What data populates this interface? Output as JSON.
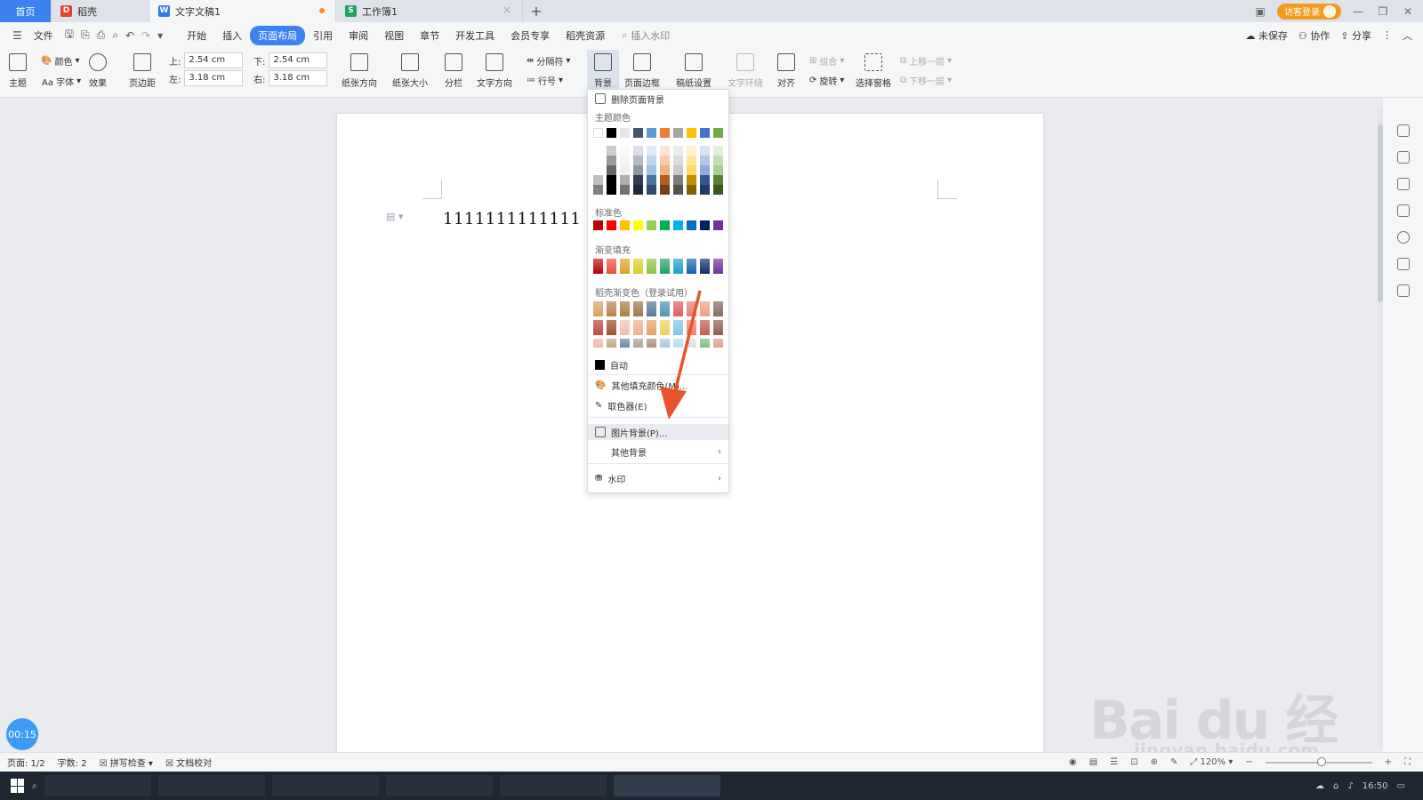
{
  "tabs": {
    "home": "首页",
    "daoke": "稻壳",
    "doc": "文字文稿1",
    "sheet": "工作簿1",
    "new": "+",
    "login": "访客登录"
  },
  "menu": {
    "file": "文件",
    "items": [
      "开始",
      "插入",
      "页面布局",
      "引用",
      "审阅",
      "视图",
      "章节",
      "开发工具",
      "会员专享",
      "稻壳资源"
    ],
    "active_index": 2,
    "search_placeholder": "插入水印",
    "unsaved": "未保存",
    "collab": "协作",
    "share": "分享"
  },
  "ribbon": {
    "theme": "主题",
    "color": "颜色",
    "font": "Aa 字体",
    "effect": "效果",
    "margin": "页边距",
    "margin_top_label": "上:",
    "margin_top": "2.54 cm",
    "margin_bottom_label": "下:",
    "margin_bottom": "2.54 cm",
    "margin_left_label": "左:",
    "margin_left": "3.18 cm",
    "margin_right_label": "右:",
    "margin_right": "3.18 cm",
    "orientation": "纸张方向",
    "size": "纸张大小",
    "columns": "分栏",
    "text_dir": "文字方向",
    "separator": "分隔符",
    "line_no": "行号",
    "background": "背景",
    "page_border": "页面边框",
    "draft": "稿纸设置",
    "wrap": "文字环绕",
    "align": "对齐",
    "group": "组合",
    "rotate": "旋转",
    "select_pane": "选择窗格",
    "bring_up": "上移一层",
    "send_down": "下移一层"
  },
  "document": {
    "text": "1111111111111"
  },
  "dropdown": {
    "remove_bg": "删除页面背景",
    "theme_colors": "主题颜色",
    "standard_colors": "标准色",
    "gradient_fill": "渐变填充",
    "daoke_gradient": "稻壳渐变色（登录试用）",
    "auto": "自动",
    "more_fill": "其他填充颜色(M)...",
    "eyedropper": "取色器(E)",
    "picture_bg": "图片背景(P)...",
    "other_bg": "其他背景",
    "watermark": "水印",
    "theme_top": [
      "#ffffff",
      "#000000",
      "#e7e6e6",
      "#44546a",
      "#5b9bd5",
      "#ed7d31",
      "#a5a5a5",
      "#ffc000",
      "#4472c4",
      "#70ad47"
    ],
    "standard": [
      "#c00000",
      "#ff0000",
      "#ffc000",
      "#ffff00",
      "#92d050",
      "#00b050",
      "#00b0f0",
      "#0070c0",
      "#002060",
      "#7030a0"
    ],
    "gradient": [
      "#c00000",
      "#e84b3c",
      "#e0a020",
      "#d8d020",
      "#8cc040",
      "#20a060",
      "#1aa0d0",
      "#1060b0",
      "#102a70",
      "#7030a0"
    ]
  },
  "status": {
    "page": "页面: 1/2",
    "words": "字数: 2",
    "spell": "拼写检查",
    "proof": "文档校对",
    "zoom": "120%"
  },
  "timer": "00:15",
  "clock": "16:50",
  "watermark": {
    "brand": "Bai du 经验",
    "url": "jingyan.baidu.com"
  },
  "colors": {
    "accent": "#3d82f0",
    "arrow": "#e8542a"
  }
}
